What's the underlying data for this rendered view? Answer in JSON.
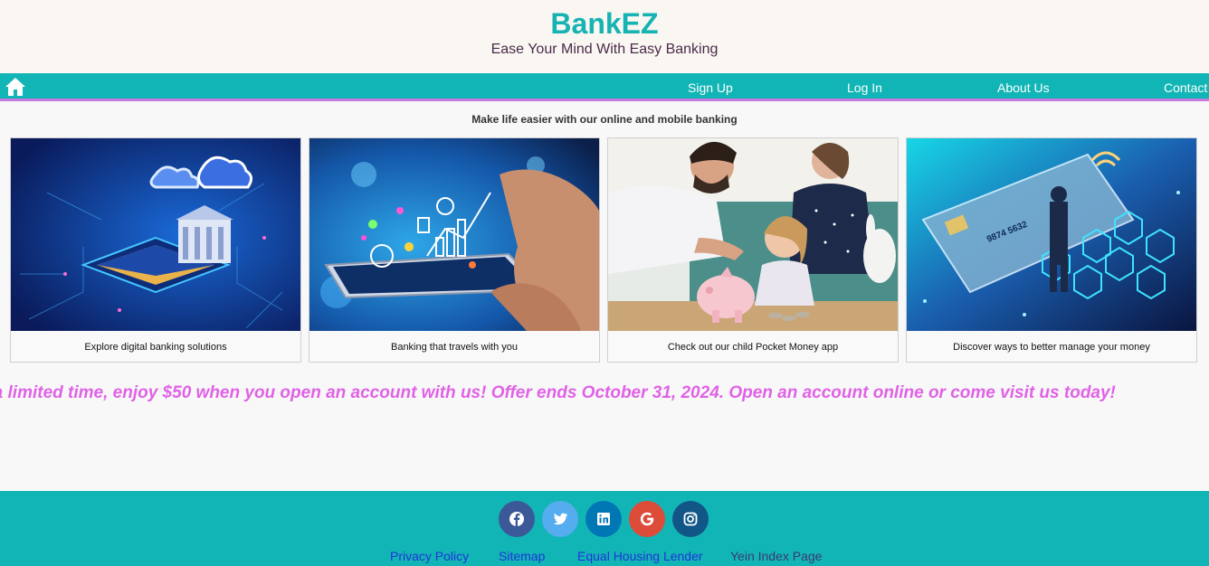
{
  "header": {
    "brand": "BankEZ",
    "tagline": "Ease Your Mind With Easy Banking"
  },
  "nav": {
    "home_icon": "home-icon",
    "links": [
      "Sign Up",
      "Log In",
      "About Us",
      "Contact"
    ]
  },
  "intro": "Make life easier with our online and mobile banking",
  "cards": [
    {
      "caption": "Explore digital banking solutions"
    },
    {
      "caption": "Banking that travels with you"
    },
    {
      "caption": "Check out our child Pocket Money app"
    },
    {
      "caption": "Discover ways to better manage your money"
    }
  ],
  "promo": "r a limited time, enjoy $50 when you open an account with us! Offer ends October 31, 2024. Open an account online or come visit us today!",
  "footer": {
    "social": [
      {
        "icon": "facebook-icon",
        "color": "#3b5998"
      },
      {
        "icon": "twitter-icon",
        "color": "#55acee"
      },
      {
        "icon": "linkedin-icon",
        "color": "#0077b5"
      },
      {
        "icon": "google-icon",
        "color": "#dd4b39"
      },
      {
        "icon": "instagram-icon",
        "color": "#125688"
      }
    ],
    "links": [
      "Privacy Policy",
      "Sitemap",
      "Equal Housing Lender",
      "Yein Index Page"
    ]
  },
  "colors": {
    "accent": "#12b5b5",
    "brand": "#17b3b3",
    "nav_border": "#c77ae0",
    "promo": "#e062e6"
  }
}
